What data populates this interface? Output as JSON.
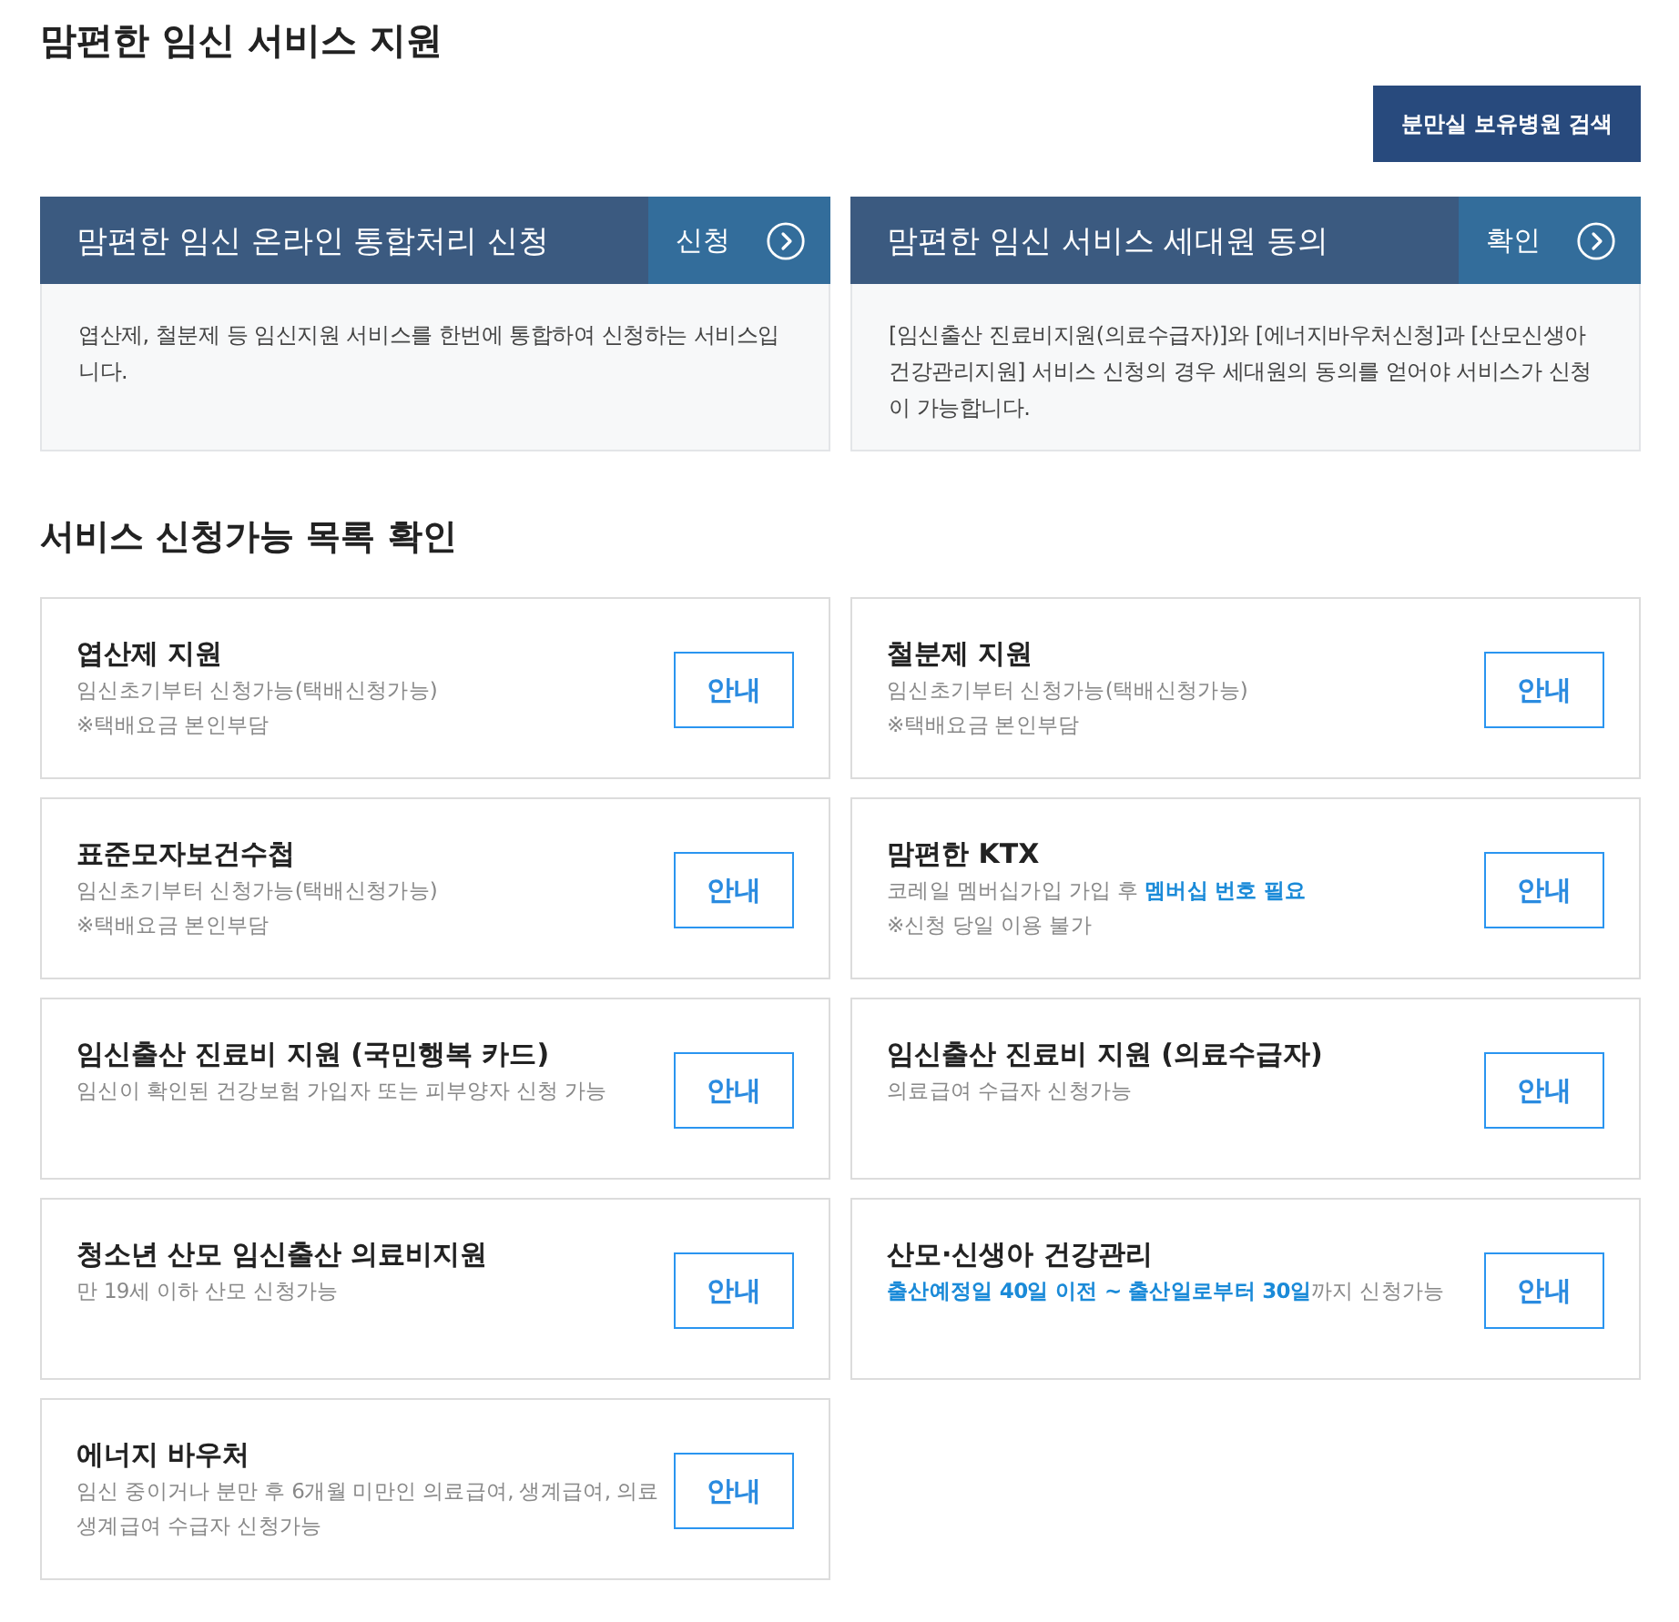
{
  "page_title": "맘편한 임신 서비스 지원",
  "search_button": {
    "label": "분만실 보유병원 검색"
  },
  "feature_cards": [
    {
      "title": "맘편한 임신 온라인 통합처리 신청",
      "action": "신청",
      "description": "엽산제, 철분제 등 임신지원 서비스를 한번에 통합하여 신청하는 서비스입니다."
    },
    {
      "title": "맘편한 임신 서비스 세대원 동의",
      "action": "확인",
      "description": "[임신출산 진료비지원(의료수급자)]와 [에너지바우처신청]과 [산모신생아건강관리지원] 서비스 신청의 경우 세대원의 동의를 얻어야 서비스가 신청이 가능합니다."
    }
  ],
  "section_title": "서비스 신청가능 목록 확인",
  "services": [
    {
      "title": "엽산제 지원",
      "description_lines": [
        "임신초기부터 신청가능(택배신청가능)",
        "※택배요금 본인부담"
      ],
      "button": "안내"
    },
    {
      "title": "철분제 지원",
      "description_lines": [
        "임신초기부터 신청가능(택배신청가능)",
        "※택배요금 본인부담"
      ],
      "button": "안내"
    },
    {
      "title": "표준모자보건수첩",
      "description_lines": [
        "임신초기부터 신청가능(택배신청가능)",
        "※택배요금 본인부담"
      ],
      "button": "안내"
    },
    {
      "title": "맘편한 KTX",
      "description_lines": [
        "코레일 멤버십가입 가입 후 **멤버십 번호 필요**",
        "※신청 당일 이용 불가"
      ],
      "button": "안내"
    },
    {
      "title": "임신출산 진료비 지원 (국민행복 카드)",
      "description_lines": [
        "임신이 확인된 건강보험 가입자 또는 피부양자 신청 가능"
      ],
      "button": "안내"
    },
    {
      "title": "임신출산 진료비 지원 (의료수급자)",
      "description_lines": [
        "의료급여 수급자 신청가능"
      ],
      "button": "안내"
    },
    {
      "title": "청소년 산모 임신출산 의료비지원",
      "description_lines": [
        "만 19세 이하 산모 신청가능"
      ],
      "button": "안내"
    },
    {
      "title": "산모·신생아 건강관리",
      "description_lines": [
        "**출산예정일 40일 이전 ~ 출산일로부터 30일**까지 신청가능"
      ],
      "button": "안내"
    },
    {
      "title": "에너지 바우처",
      "description_lines": [
        "임신 중이거나 분만 후 6개월 미만인 의료급여, 생계급여, 의료생계급여 수급자 신청가능"
      ],
      "button": "안내"
    }
  ]
}
